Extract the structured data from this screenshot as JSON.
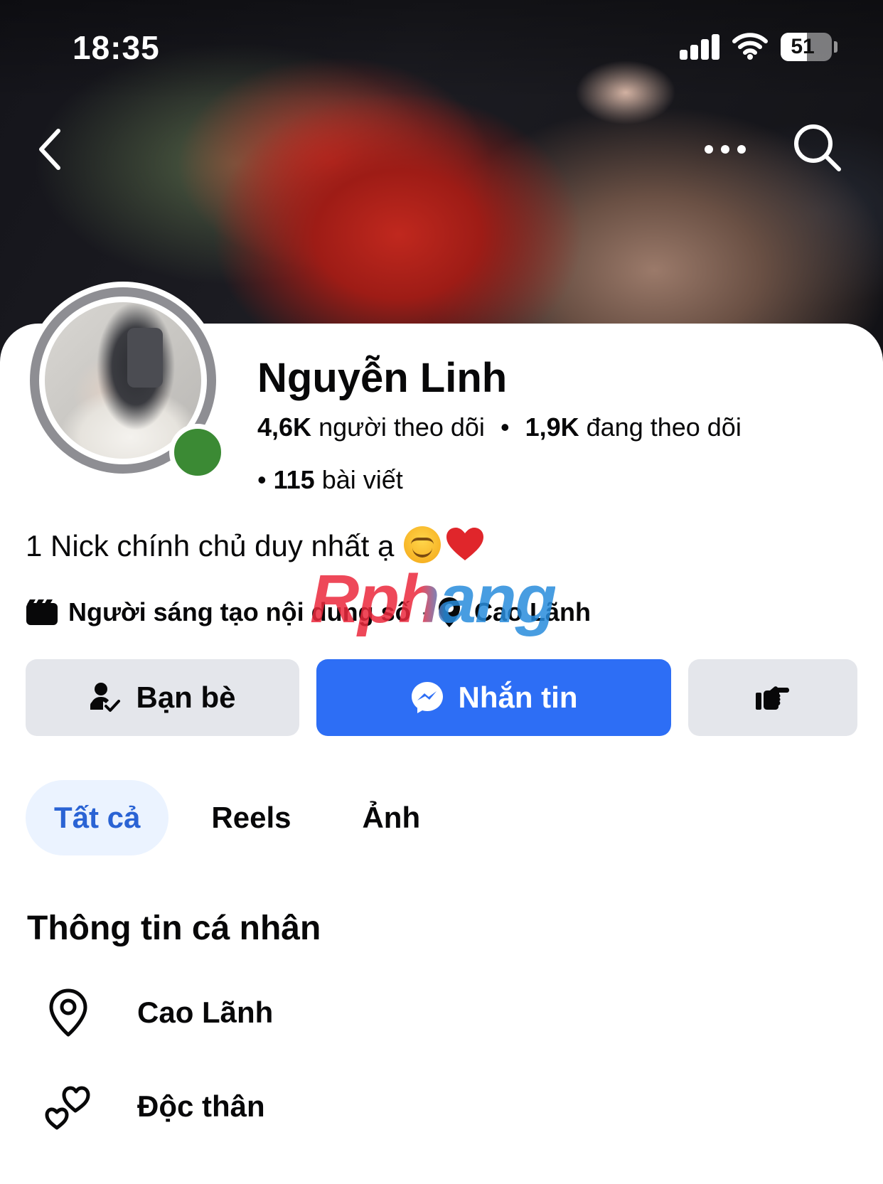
{
  "status_bar": {
    "time": "18:35",
    "battery_level": "51",
    "battery_fraction": 0.51
  },
  "nav": {
    "back_icon": "chevron-left-icon",
    "more_icon": "ellipsis-icon",
    "search_icon": "search-icon"
  },
  "profile": {
    "name": "Nguyễn Linh",
    "online": true,
    "followers_count": "4,6K",
    "followers_label": "người theo dõi",
    "following_count": "1,9K",
    "following_label": "đang theo dõi",
    "posts_count": "115",
    "posts_label": "bài viết",
    "bio": "1 Nick chính chủ duy nhất ạ",
    "category": "Người sáng tạo nội dung số",
    "location": "Cao Lãnh"
  },
  "watermark": "Rphang",
  "actions": {
    "friends_label": "Bạn bè",
    "message_label": "Nhắn tin",
    "poke_icon": "poke-hand-icon"
  },
  "tabs": [
    {
      "label": "Tất cả",
      "active": true
    },
    {
      "label": "Reels",
      "active": false
    },
    {
      "label": "Ảnh",
      "active": false
    }
  ],
  "about": {
    "title": "Thông tin cá nhân",
    "location": "Cao Lãnh",
    "relationship": "Độc thân"
  },
  "colors": {
    "primary_blue": "#2d6ef5",
    "active_tab_bg": "#ebf3ff",
    "active_tab_text": "#2a63d4",
    "secondary_button": "#e4e6eb",
    "online_green": "#3b8a34"
  }
}
